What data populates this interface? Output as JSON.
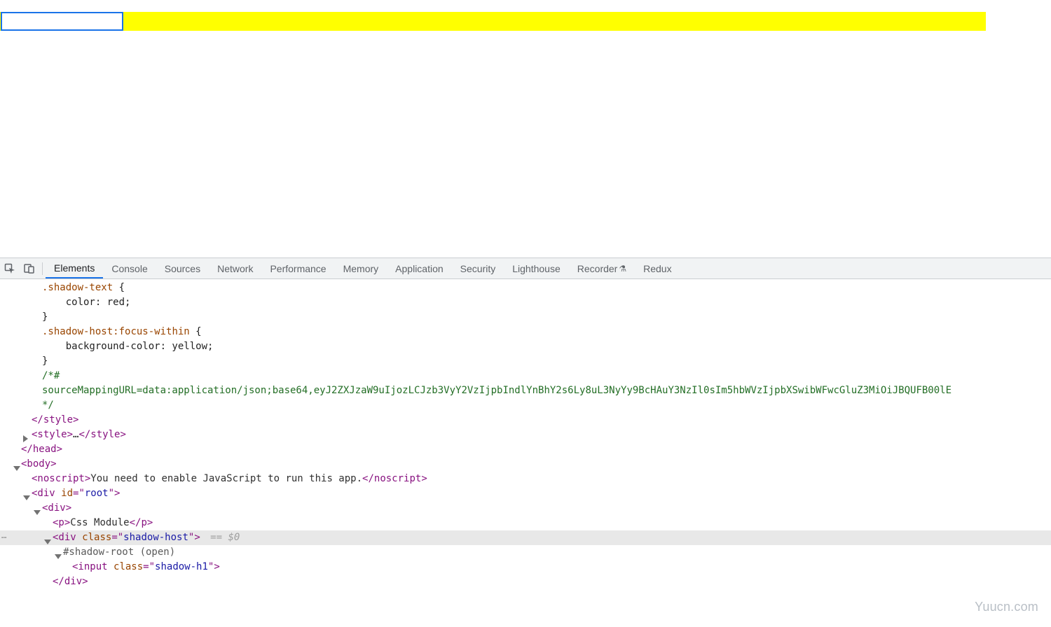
{
  "devtools": {
    "tabs": [
      "Elements",
      "Console",
      "Sources",
      "Network",
      "Performance",
      "Memory",
      "Application",
      "Security",
      "Lighthouse",
      "Recorder",
      "Redux"
    ],
    "active_tab": "Elements"
  },
  "css": {
    "rule1_selector": ".shadow-text",
    "rule1_open": " {",
    "rule1_decl": "    color: red;",
    "rule1_close": "}",
    "blank": "",
    "rule2_sel_a": ".shadow-host",
    "rule2_sel_b": ":focus-within",
    "rule2_open": " {",
    "rule2_decl": "    background-color: yellow;",
    "rule2_close": "}",
    "comment_open": "/*#",
    "comment_body": "sourceMappingURL=data:application/json;base64,eyJ2ZXJzaW9uIjozLCJzb3VyY2VzIjpbIndlYnBhY2s6Ly8uL3NyYy9BcHAuY3NzIl0sIm5hbWVzIjpbXSwibWFwcGluZ3MiOiJBQUFB00lE",
    "comment_close": "*/",
    "style_close": "</style>",
    "style_collapsed_open": "<style>",
    "style_collapsed_ellipsis": "…",
    "style_collapsed_close": "</style>"
  },
  "dom": {
    "head_close": "</head>",
    "body_open": "<body>",
    "noscript_open": "<noscript>",
    "noscript_text": "You need to enable JavaScript to run this app.",
    "noscript_close": "</noscript>",
    "root_open_1": "<div ",
    "root_attr_n": "id",
    "root_eq": "=\"",
    "root_attr_v": "root",
    "root_open_2": "\">",
    "div_open": "<div>",
    "p_open": "<p>",
    "p_text": "Css Module",
    "p_close": "</p>",
    "sh_open_1": "<div ",
    "sh_attr_n": "class",
    "sh_attr_v": "shadow-host",
    "sh_open_2": "\">",
    "eq0": " == $0",
    "shadow_root": "#shadow-root (open)",
    "input_open_1": "<input ",
    "input_attr_n": "class",
    "input_attr_v": "shadow-h1",
    "input_open_2": "\">",
    "div_close": "</div>"
  },
  "watermark": "Yuucn.com"
}
